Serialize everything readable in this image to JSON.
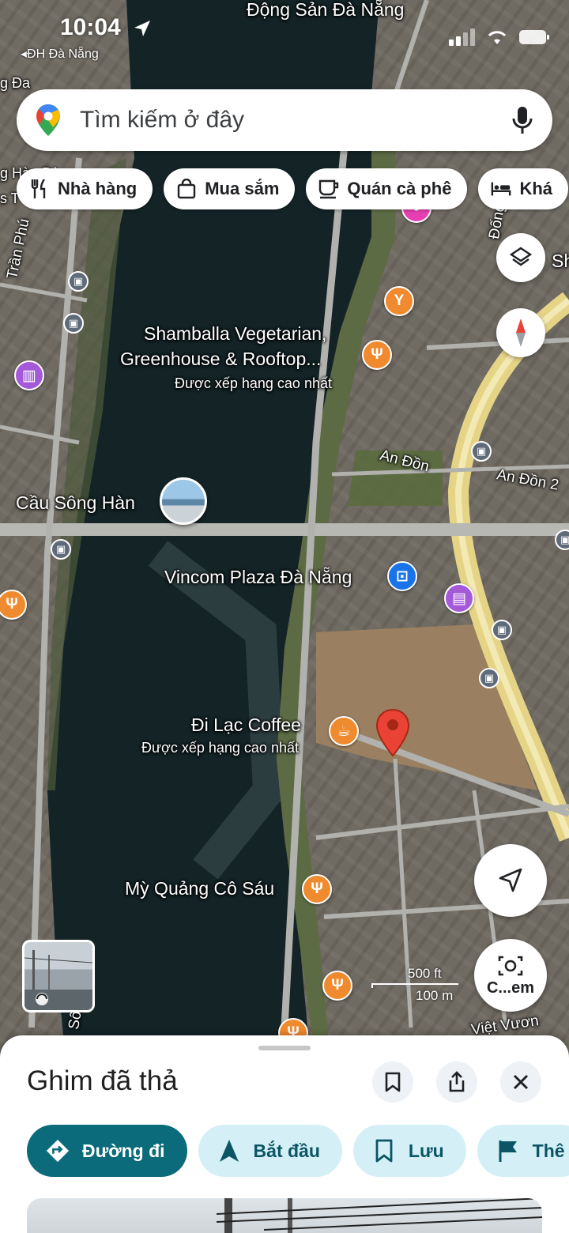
{
  "status_bar": {
    "time": "10:04",
    "back_app": "ĐH Đà Nẵng"
  },
  "search": {
    "placeholder": "Tìm kiếm ở đây"
  },
  "chips": [
    {
      "label": "Nhà hàng",
      "icon": "fork-knife-icon"
    },
    {
      "label": "Mua sắm",
      "icon": "shopping-bag-icon"
    },
    {
      "label": "Quán cà phê",
      "icon": "coffee-cup-icon"
    },
    {
      "label": "Khá",
      "icon": "bed-icon"
    }
  ],
  "map": {
    "labels": {
      "top_place": "Động Sản Đà Nẵng",
      "left_edge_1": "g Đa",
      "left_edge_2": "g Hàn Đà",
      "left_edge_3": "s T",
      "tran_phu": "Trần Phú",
      "dong_da": "Đống Đa",
      "sh": "Sh",
      "shamballa_line1": "Shamballa Vegetarian,",
      "shamballa_line2": "Greenhouse & Rooftop...",
      "shamballa_rating": "Được xếp hạng cao nhất",
      "an_don": "An Đồn",
      "an_don_2": "An Đồn 2",
      "cau_song_han": "Cầu Sông Hàn",
      "vincom": "Vincom Plaza Đà Nẵng",
      "di_lac": "Đi Lạc Coffee",
      "di_lac_rating": "Được xếp hạng cao nhất",
      "my_quang": "Mỳ Quảng Cô Sáu",
      "viet_vuong": "Việt Vươn",
      "song_han_road": "Sông Hàn",
      "scale_ft": "500 ft",
      "scale_m": "100 m"
    },
    "controls": {
      "camera_label": "C...em"
    }
  },
  "sheet": {
    "title": "Ghim đã thả",
    "actions": [
      {
        "label": "Đường đi",
        "icon": "directions-icon"
      },
      {
        "label": "Bắt đầu",
        "icon": "navigation-arrow-icon"
      },
      {
        "label": "Lưu",
        "icon": "bookmark-icon"
      },
      {
        "label": "Thê",
        "icon": "flag-icon"
      }
    ]
  }
}
